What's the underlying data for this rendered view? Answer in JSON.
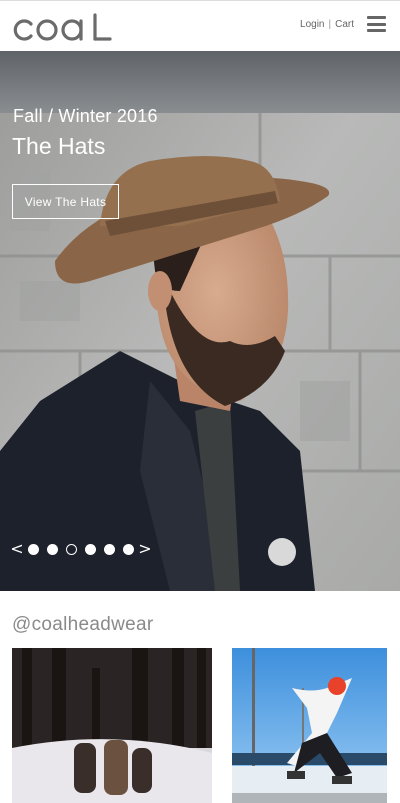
{
  "header": {
    "logo_text": "coal",
    "login_label": "Login",
    "separator": "|",
    "cart_label": "Cart",
    "menu_icon": "hamburger-menu-icon"
  },
  "hero": {
    "kicker": "Fall / Winter 2016",
    "title": "The Hats",
    "cta_label": "View The Hats",
    "slides_total": 6,
    "active_slide": 3,
    "prev_glyph": "<",
    "next_glyph": ">"
  },
  "instagram": {
    "handle": "@coalheadwear",
    "photos": [
      "snowboarders-in-forest-photo",
      "snowboard-jump-photo"
    ]
  },
  "colors": {
    "accent_text": "#666666",
    "hero_text": "#ffffff",
    "handle_text": "#8a8a8a"
  }
}
